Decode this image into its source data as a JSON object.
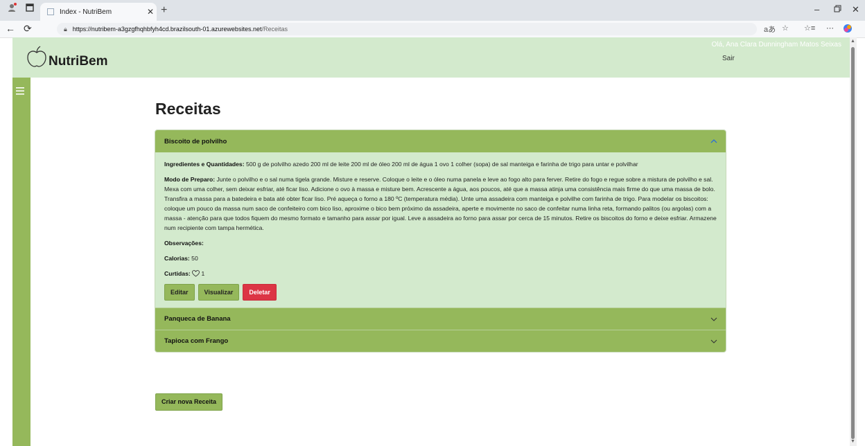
{
  "browser": {
    "tab_title": "Index - NutriBem",
    "url_host": "https://nutribem-a3gzgfhqhbfyh4cd.brazilsouth-01.azurewebsites.net",
    "url_path": "/Receitas"
  },
  "header": {
    "brand": "NutriBem",
    "greeting": "Olá, Ana Clara Dunningham Matos Seixas",
    "logout": "Sair"
  },
  "page": {
    "title": "Receitas",
    "create_button": "Criar nova Receita"
  },
  "recipes": [
    {
      "name": "Biscoito de polvilho",
      "expanded": true,
      "ingredients_label": "Ingredientes e Quantidades:",
      "ingredients": " 500 g de polvilho azedo 200 ml de leite 200 ml de óleo 200 ml de água 1 ovo 1 colher (sopa) de sal manteiga e farinha de trigo para untar e polvilhar",
      "method_label": "Modo de Preparo:",
      "method": " Junte o polvilho e o sal numa tigela grande. Misture e reserve. Coloque o leite e o óleo numa panela e leve ao fogo alto para ferver. Retire do fogo e regue sobre a mistura de polvilho e sal. Mexa com uma colher, sem deixar esfriar, até ficar liso. Adicione o ovo à massa e misture bem. Acrescente a água, aos poucos, até que a massa atinja uma consistência mais firme do que uma massa de bolo. Transfira a massa para a batedeira e bata até obter ficar liso. Pré aqueça o forno a 180 ºC (temperatura média). Unte uma assadeira com manteiga e polvilhe com farinha de trigo. Para modelar os biscoitos: coloque um pouco da massa num saco de confeiteiro com bico liso, aproxime o bico bem próximo da assadeira, aperte e movimente no saco de confeitar numa linha reta, formando palitos (ou argolas) com a massa - atenção para que todos fiquem do mesmo formato e tamanho para assar por igual. Leve a assadeira ao forno para assar por cerca de 15 minutos. Retire os biscoitos do forno e deixe esfriar. Armazene num recipiente com tampa hermética.",
      "notes_label": "Observações:",
      "calories_label": "Calorias:",
      "calories": " 50",
      "likes_label": "Curtidas:",
      "likes": "1",
      "edit": "Editar",
      "view": "Visualizar",
      "delete": "Deletar"
    },
    {
      "name": "Panqueca de Banana",
      "expanded": false
    },
    {
      "name": "Tapioca com Frango",
      "expanded": false
    }
  ],
  "icons": {
    "brand_icon": "apple-outline-icon",
    "menu_icon": "hamburger-menu-icon",
    "like_icon": "heart-outline-icon",
    "expanded_icon": "chevron-up-icon",
    "collapsed_icon": "chevron-down-icon"
  },
  "colors": {
    "primary_green": "#95b85b",
    "light_green": "#d3eacd",
    "danger": "#dc3545"
  }
}
